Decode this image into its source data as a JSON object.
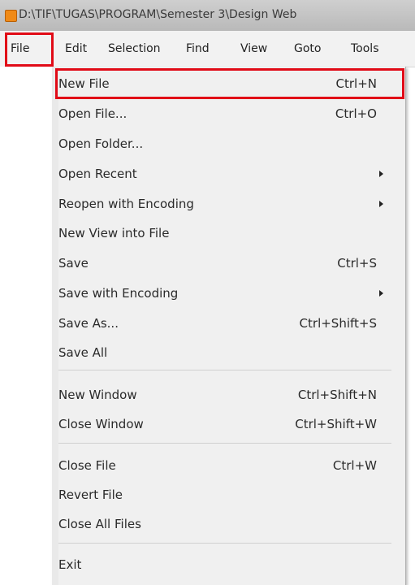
{
  "window": {
    "title": "D:\\TIF\\TUGAS\\PROGRAM\\Semester 3\\Design Web"
  },
  "menubar": {
    "items": [
      "File",
      "Edit",
      "Selection",
      "Find",
      "View",
      "Goto",
      "Tools"
    ]
  },
  "file_menu": {
    "items": [
      {
        "label": "New File",
        "shortcut": "Ctrl+N"
      },
      {
        "label": "Open File...",
        "shortcut": "Ctrl+O"
      },
      {
        "label": "Open Folder...",
        "shortcut": ""
      },
      {
        "label": "Open Recent",
        "shortcut": ""
      },
      {
        "label": "Reopen with Encoding",
        "shortcut": ""
      },
      {
        "label": "New View into File",
        "shortcut": ""
      },
      {
        "label": "Save",
        "shortcut": "Ctrl+S"
      },
      {
        "label": "Save with Encoding",
        "shortcut": ""
      },
      {
        "label": "Save As...",
        "shortcut": "Ctrl+Shift+S"
      },
      {
        "label": "Save All",
        "shortcut": ""
      },
      {
        "label": "New Window",
        "shortcut": "Ctrl+Shift+N"
      },
      {
        "label": "Close Window",
        "shortcut": "Ctrl+Shift+W"
      },
      {
        "label": "Close File",
        "shortcut": "Ctrl+W"
      },
      {
        "label": "Revert File",
        "shortcut": ""
      },
      {
        "label": "Close All Files",
        "shortcut": ""
      },
      {
        "label": "Exit",
        "shortcut": ""
      }
    ]
  },
  "colors": {
    "highlight_border": "#e10b17",
    "menu_background": "#f0f0f0",
    "app_icon": "#f08a17"
  }
}
